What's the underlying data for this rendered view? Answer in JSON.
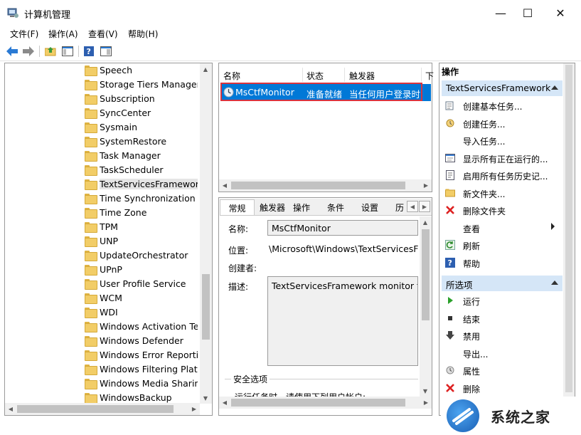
{
  "window": {
    "title": "计算机管理",
    "minimize": "—",
    "maximize": "☐",
    "close": "✕"
  },
  "menu": [
    "文件(F)",
    "操作(A)",
    "查看(V)",
    "帮助(H)"
  ],
  "tree": {
    "items": [
      {
        "label": "Speech"
      },
      {
        "label": "Storage Tiers Managem"
      },
      {
        "label": "Subscription"
      },
      {
        "label": "SyncCenter"
      },
      {
        "label": "Sysmain"
      },
      {
        "label": "SystemRestore"
      },
      {
        "label": "Task Manager"
      },
      {
        "label": "TaskScheduler"
      },
      {
        "label": "TextServicesFramework"
      },
      {
        "label": "Time Synchronization"
      },
      {
        "label": "Time Zone"
      },
      {
        "label": "TPM"
      },
      {
        "label": "UNP"
      },
      {
        "label": "UpdateOrchestrator"
      },
      {
        "label": "UPnP"
      },
      {
        "label": "User Profile Service"
      },
      {
        "label": "WCM"
      },
      {
        "label": "WDI"
      },
      {
        "label": "Windows Activation Tec"
      },
      {
        "label": "Windows Defender"
      },
      {
        "label": "Windows Error Reportin"
      },
      {
        "label": "Windows Filtering Platfo"
      },
      {
        "label": "Windows Media Sharin"
      },
      {
        "label": "WindowsBackup"
      }
    ],
    "selected_index": 8
  },
  "task_list": {
    "columns": [
      "名称",
      "状态",
      "触发器",
      "下"
    ],
    "row": {
      "name": "MsCtfMonitor",
      "status": "准备就绪",
      "trigger": "当任何用户登录时"
    }
  },
  "tabs": [
    "常规",
    "触发器",
    "操作",
    "条件",
    "设置",
    "历"
  ],
  "general": {
    "name_label": "名称:",
    "name_value": "MsCtfMonitor",
    "location_label": "位置:",
    "location_value": "\\Microsoft\\Windows\\TextServicesFra",
    "author_label": "创建者:",
    "desc_label": "描述:",
    "desc_value": "TextServicesFramework monitor tas",
    "security_label": "安全选项",
    "security_text": "运行任务时，请使用下列用户帐户:"
  },
  "actions": {
    "header": "操作",
    "section1": "TextServicesFramework",
    "items1": [
      {
        "label": "创建基本任务...",
        "icon": "wand-icon"
      },
      {
        "label": "创建任务...",
        "icon": "task-icon"
      },
      {
        "label": "导入任务...",
        "icon": ""
      },
      {
        "label": "显示所有正在运行的...",
        "icon": "running-icon"
      },
      {
        "label": "启用所有任务历史记...",
        "icon": "history-icon"
      },
      {
        "label": "新文件夹...",
        "icon": "folder-icon"
      },
      {
        "label": "删除文件夹",
        "icon": "delete-icon"
      },
      {
        "label": "查看",
        "icon": ""
      },
      {
        "label": "刷新",
        "icon": "refresh-icon"
      },
      {
        "label": "帮助",
        "icon": "help-icon"
      }
    ],
    "section2": "所选项",
    "items2": [
      {
        "label": "运行",
        "icon": "play-icon"
      },
      {
        "label": "结束",
        "icon": "stop-icon"
      },
      {
        "label": "禁用",
        "icon": "disable-icon"
      },
      {
        "label": "导出...",
        "icon": ""
      },
      {
        "label": "属性",
        "icon": "properties-icon"
      },
      {
        "label": "删除",
        "icon": "delete-icon"
      }
    ]
  },
  "watermark": {
    "text": "系统之家"
  },
  "colors": {
    "selection": "#0078d7",
    "highlight_border": "#d9343e",
    "section_bg": "#d5e6f7"
  }
}
